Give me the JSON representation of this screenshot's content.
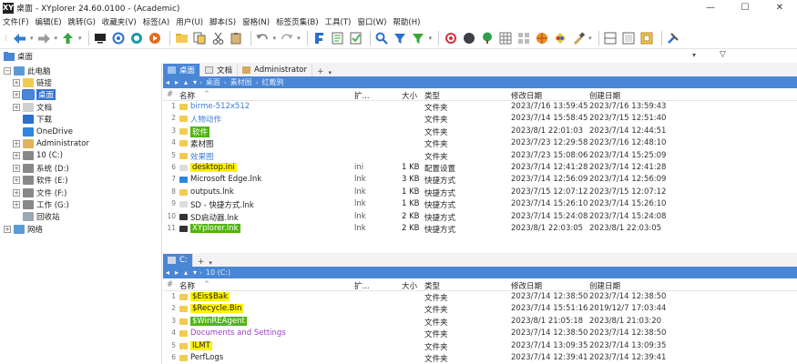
{
  "window": {
    "title": "桌面 - XYplorer 24.60.0100 - (Academic)",
    "icon": "XY",
    "minimize": "—",
    "maximize": "☐",
    "close": "✕"
  },
  "menu": [
    "文件(F)",
    "编辑(E)",
    "跳转(G)",
    "收藏夹(V)",
    "标签(A)",
    "用户(U)",
    "脚本(S)",
    "窗格(N)",
    "标签页集(B)",
    "工具(T)",
    "窗口(W)",
    "帮助(H)"
  ],
  "address": {
    "text": "桌面"
  },
  "tree": [
    {
      "label": "此电脑",
      "icon_color": "#5b9bd5",
      "expander": "−"
    },
    {
      "label": "链接",
      "icon_color": "#f2cb52",
      "expander": "+"
    },
    {
      "label": "桌面",
      "icon_color": "#4a86d6",
      "expander": "+",
      "selected": true
    },
    {
      "label": "文档",
      "icon_color": "#cfcfcf",
      "expander": "+"
    },
    {
      "label": "下载",
      "icon_color": "#2b6fd1",
      "expander": ""
    },
    {
      "label": "OneDrive",
      "icon_color": "#2e86de",
      "expander": ""
    },
    {
      "label": "Administrator",
      "icon_color": "#e0b45a",
      "expander": "+"
    },
    {
      "label": "10 (C:)",
      "icon_color": "#888888",
      "expander": "+"
    },
    {
      "label": "系统 (D:)",
      "icon_color": "#888888",
      "expander": "+"
    },
    {
      "label": "软件 (E:)",
      "icon_color": "#888888",
      "expander": "+"
    },
    {
      "label": "文件 (F:)",
      "icon_color": "#888888",
      "expander": "+"
    },
    {
      "label": "工作 (G:)",
      "icon_color": "#888888",
      "expander": "+"
    },
    {
      "label": "回收站",
      "icon_color": "#9aa7b5",
      "expander": ""
    },
    {
      "label": "网络",
      "icon_color": "#5b9bd5",
      "expander": "+"
    }
  ],
  "pane1": {
    "tabs": [
      {
        "label": "桌面",
        "active": true
      },
      {
        "label": "文档",
        "active": false
      },
      {
        "label": "Administrator",
        "active": false
      }
    ],
    "tab_plus": "+",
    "tab_chevron": "▾",
    "breadcrumb": [
      "桌面",
      "素材图",
      "红戴鸦"
    ],
    "columns": {
      "num": "#",
      "name": "名称",
      "ext": "扩...",
      "size": "大小",
      "type": "类型",
      "modified": "修改日期",
      "created": "创建日期"
    },
    "rows": [
      {
        "num": "1",
        "name": "birme-512x512",
        "ext": "",
        "size": "",
        "type": "文件夹",
        "modified": "2023/7/16 13:59:45",
        "created": "2023/7/16 13:59:43",
        "style": "blue",
        "icon": "#f2cb52"
      },
      {
        "num": "2",
        "name": "人物动作",
        "ext": "",
        "size": "",
        "type": "文件夹",
        "modified": "2023/7/14 15:58:45",
        "created": "2023/7/15 12:51:40",
        "style": "blue",
        "icon": "#f2cb52"
      },
      {
        "num": "3",
        "name": "软件",
        "ext": "",
        "size": "",
        "type": "文件夹",
        "modified": "2023/8/1 22:01:03",
        "created": "2023/7/14 12:44:51",
        "style": "green",
        "icon": "#f2cb52"
      },
      {
        "num": "4",
        "name": "素材图",
        "ext": "",
        "size": "",
        "type": "文件夹",
        "modified": "2023/7/23 12:29:58",
        "created": "2023/7/16 12:48:10",
        "style": "plain",
        "icon": "#f2cb52"
      },
      {
        "num": "5",
        "name": "效果图",
        "ext": "",
        "size": "",
        "type": "文件夹",
        "modified": "2023/7/23 15:08:06",
        "created": "2023/7/14 15:25:09",
        "style": "blue",
        "icon": "#f2cb52"
      },
      {
        "num": "6",
        "name": "desktop.ini",
        "ext": "ini",
        "size": "1 KB",
        "type": "配置设置",
        "modified": "2023/7/14 12:41:28",
        "created": "2023/7/14 12:41:28",
        "style": "yellow",
        "icon": "#dddddd"
      },
      {
        "num": "7",
        "name": "Microsoft Edge.lnk",
        "ext": "lnk",
        "size": "3 KB",
        "type": "快捷方式",
        "modified": "2023/7/14 12:56:09",
        "created": "2023/7/14 12:56:09",
        "style": "plain",
        "icon": "#2e86de"
      },
      {
        "num": "8",
        "name": "outputs.lnk",
        "ext": "lnk",
        "size": "1 KB",
        "type": "快捷方式",
        "modified": "2023/7/15 12:07:12",
        "created": "2023/7/15 12:07:12",
        "style": "plain",
        "icon": "#f2cb52"
      },
      {
        "num": "9",
        "name": "SD - 快捷方式.lnk",
        "ext": "lnk",
        "size": "1 KB",
        "type": "快捷方式",
        "modified": "2023/7/14 15:26:10",
        "created": "2023/7/14 15:26:10",
        "style": "plain",
        "icon": "#dddddd"
      },
      {
        "num": "10",
        "name": "SD启动器.lnk",
        "ext": "lnk",
        "size": "2 KB",
        "type": "快捷方式",
        "modified": "2023/7/14 15:24:08",
        "created": "2023/7/14 15:24:08",
        "style": "plain",
        "icon": "#333333"
      },
      {
        "num": "11",
        "name": "XYplorer.lnk",
        "ext": "lnk",
        "size": "2 KB",
        "type": "快捷方式",
        "modified": "2023/8/1 22:03:05",
        "created": "2023/8/1 22:03:05",
        "style": "green",
        "icon": "#333333"
      }
    ]
  },
  "pane2": {
    "tabs": [
      {
        "label": "C:",
        "active": true
      }
    ],
    "tab_plus": "+",
    "tab_chevron": "▾",
    "breadcrumb": [
      "10 (C:)"
    ],
    "columns": {
      "num": "#",
      "name": "名称",
      "ext": "扩...",
      "size": "大小",
      "type": "类型",
      "modified": "修改日期",
      "created": "创建日期"
    },
    "rows": [
      {
        "num": "1",
        "name": "$Eis$Bak",
        "ext": "",
        "size": "",
        "type": "文件夹",
        "modified": "2023/7/14 12:38:50",
        "created": "2023/7/14 12:38:50",
        "style": "yellow",
        "icon": "#f2cb52"
      },
      {
        "num": "2",
        "name": "$Recycle.Bin",
        "ext": "",
        "size": "",
        "type": "文件夹",
        "modified": "2023/7/14 15:51:16",
        "created": "2019/12/7 17:03:44",
        "style": "yellow",
        "icon": "#f2cb52"
      },
      {
        "num": "3",
        "name": "$WinREAgent",
        "ext": "",
        "size": "",
        "type": "文件夹",
        "modified": "2023/8/1 21:05:18",
        "created": "2023/8/1 21:03:20",
        "style": "green",
        "icon": "#f2cb52"
      },
      {
        "num": "4",
        "name": "Documents and Settings",
        "ext": "",
        "size": "",
        "type": "文件夹",
        "modified": "2023/7/14 12:38:50",
        "created": "2023/7/14 12:38:50",
        "style": "purple",
        "icon": "#f2cb52"
      },
      {
        "num": "5",
        "name": "ILMT",
        "ext": "",
        "size": "",
        "type": "文件夹",
        "modified": "2023/7/14 13:09:35",
        "created": "2023/7/14 13:09:35",
        "style": "yellow",
        "icon": "#f2cb52"
      },
      {
        "num": "6",
        "name": "PerfLogs",
        "ext": "",
        "size": "",
        "type": "文件夹",
        "modified": "2023/7/14 12:39:41",
        "created": "2023/7/14 12:39:41",
        "style": "plain",
        "icon": "#f2cb52"
      }
    ]
  },
  "toolbar_icons": [
    "back-icon",
    "forward-icon",
    "up-icon",
    "desktop-icon",
    "refresh-icon",
    "target-icon",
    "play-icon",
    "new-folder-icon",
    "copy-icon",
    "cut-icon",
    "paste-icon",
    "undo-icon",
    "redo-icon",
    "filter-icon",
    "pin-icon",
    "check-icon",
    "search-icon",
    "funnel-icon",
    "green-filter-icon",
    "bullseye-icon",
    "dark-circle-icon",
    "tree-icon",
    "grid-icon",
    "tiles-icon",
    "ball-icon",
    "palette-icon",
    "brush-icon",
    "dual-pane-icon",
    "single-pane-icon",
    "box-icon",
    "tools-icon"
  ]
}
